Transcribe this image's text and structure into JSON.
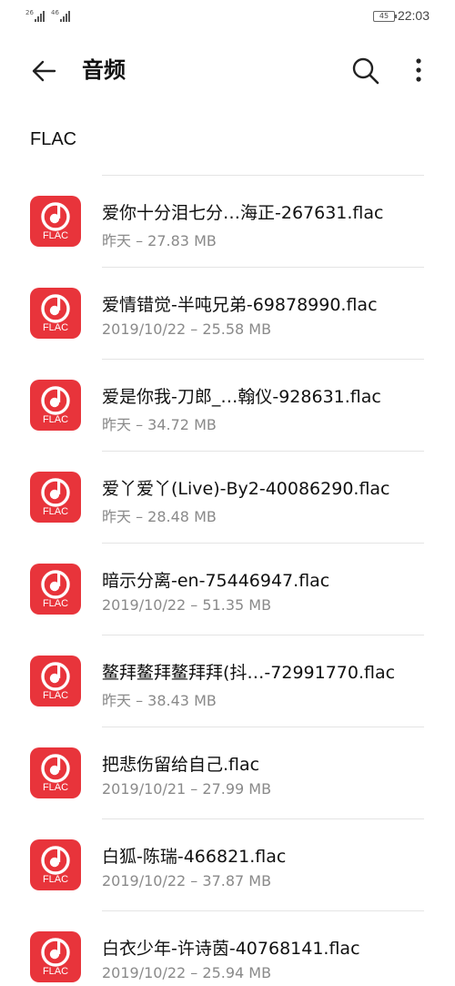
{
  "status_bar": {
    "signal1_label": "26",
    "signal2_label": "46",
    "battery": "45",
    "time": "22:03"
  },
  "app_bar": {
    "title": "音频"
  },
  "section": {
    "label": "FLAC"
  },
  "icon_ext": "FLAC",
  "colors": {
    "accent": "#e8343b",
    "meta_text": "#8a8a8a",
    "divider": "#e4e4e4"
  },
  "files": [
    {
      "name": "爱你十分泪七分…海正-267631.flac",
      "meta": "昨天 – 27.83 MB"
    },
    {
      "name": "爱情错觉-半吨兄弟-69878990.flac",
      "meta": "2019/10/22 – 25.58 MB"
    },
    {
      "name": "爱是你我-刀郎_…翰仪-928631.flac",
      "meta": "昨天 – 34.72 MB"
    },
    {
      "name": "爱丫爱丫(Live)-By2-40086290.flac",
      "meta": "昨天 – 28.48 MB"
    },
    {
      "name": "暗示分离-en-75446947.flac",
      "meta": "2019/10/22 – 51.35 MB"
    },
    {
      "name": "鳌拜鳌拜鳌拜拜(抖…-72991770.flac",
      "meta": "昨天 – 38.43 MB"
    },
    {
      "name": "把悲伤留给自己.flac",
      "meta": "2019/10/21 – 27.99 MB"
    },
    {
      "name": "白狐-陈瑞-466821.flac",
      "meta": "2019/10/22 – 37.87 MB"
    },
    {
      "name": "白衣少年-许诗茵-40768141.flac",
      "meta": "2019/10/22 – 25.94 MB"
    }
  ]
}
